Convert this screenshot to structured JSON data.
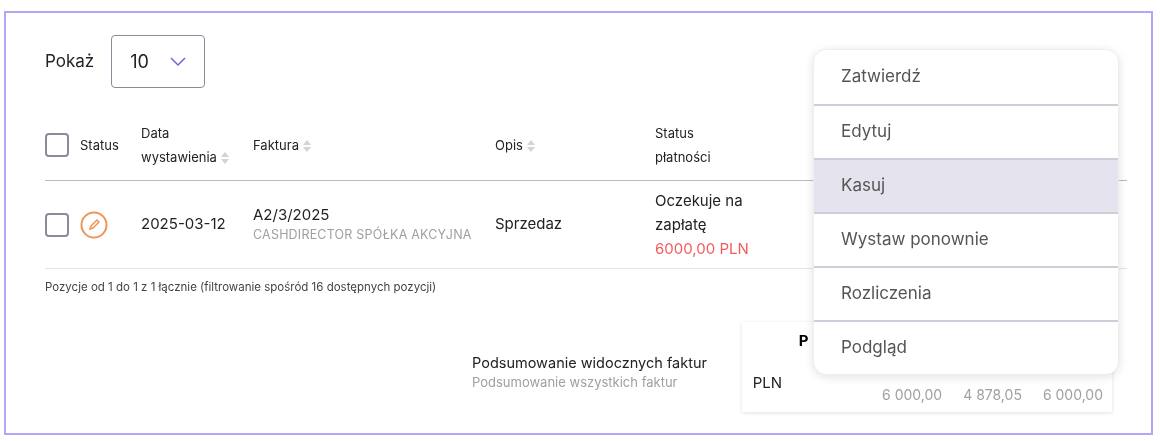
{
  "page_size": {
    "label": "Pokaż",
    "value": "10"
  },
  "table": {
    "columns": [
      {
        "label": "Status",
        "sortable": false
      },
      {
        "label": "Data wystawienia",
        "sortable": true
      },
      {
        "label": "Faktura",
        "sortable": true
      },
      {
        "label": "Opis",
        "sortable": true
      },
      {
        "label": "Status płatności",
        "sortable": false
      }
    ],
    "select_all": {
      "checked": false
    },
    "rows": [
      {
        "checked": false,
        "date": "2025-03-12",
        "invoice": "A2/3/2025",
        "company": "CASHDIRECTOR SPÓŁKA AKCYJNA",
        "description": "Sprzedaz",
        "payment_status": "Oczekuje na zapłatę",
        "payment_amount": "6000,00 PLN"
      }
    ]
  },
  "footer": "Pozycje od 1 do 1 z 1 łącznie (filtrowanie spośród 16 dostępnych pozycji)",
  "summary": {
    "visible_label": "Podsumowanie widocznych faktur",
    "all_label": "Podsumowanie wszystkich faktur",
    "card_heading": "P",
    "currency": "PLN",
    "values": [
      "6 000,00",
      "4 878,05",
      "6 000,00"
    ]
  },
  "menu": [
    {
      "label": "Zatwierdź",
      "selected": false
    },
    {
      "label": "Edytuj",
      "selected": false
    },
    {
      "label": "Kasuj",
      "selected": true
    },
    {
      "label": "Wystaw ponownie",
      "selected": false
    },
    {
      "label": "Rozliczenia",
      "selected": false
    },
    {
      "label": "Podgląd",
      "selected": false
    }
  ]
}
